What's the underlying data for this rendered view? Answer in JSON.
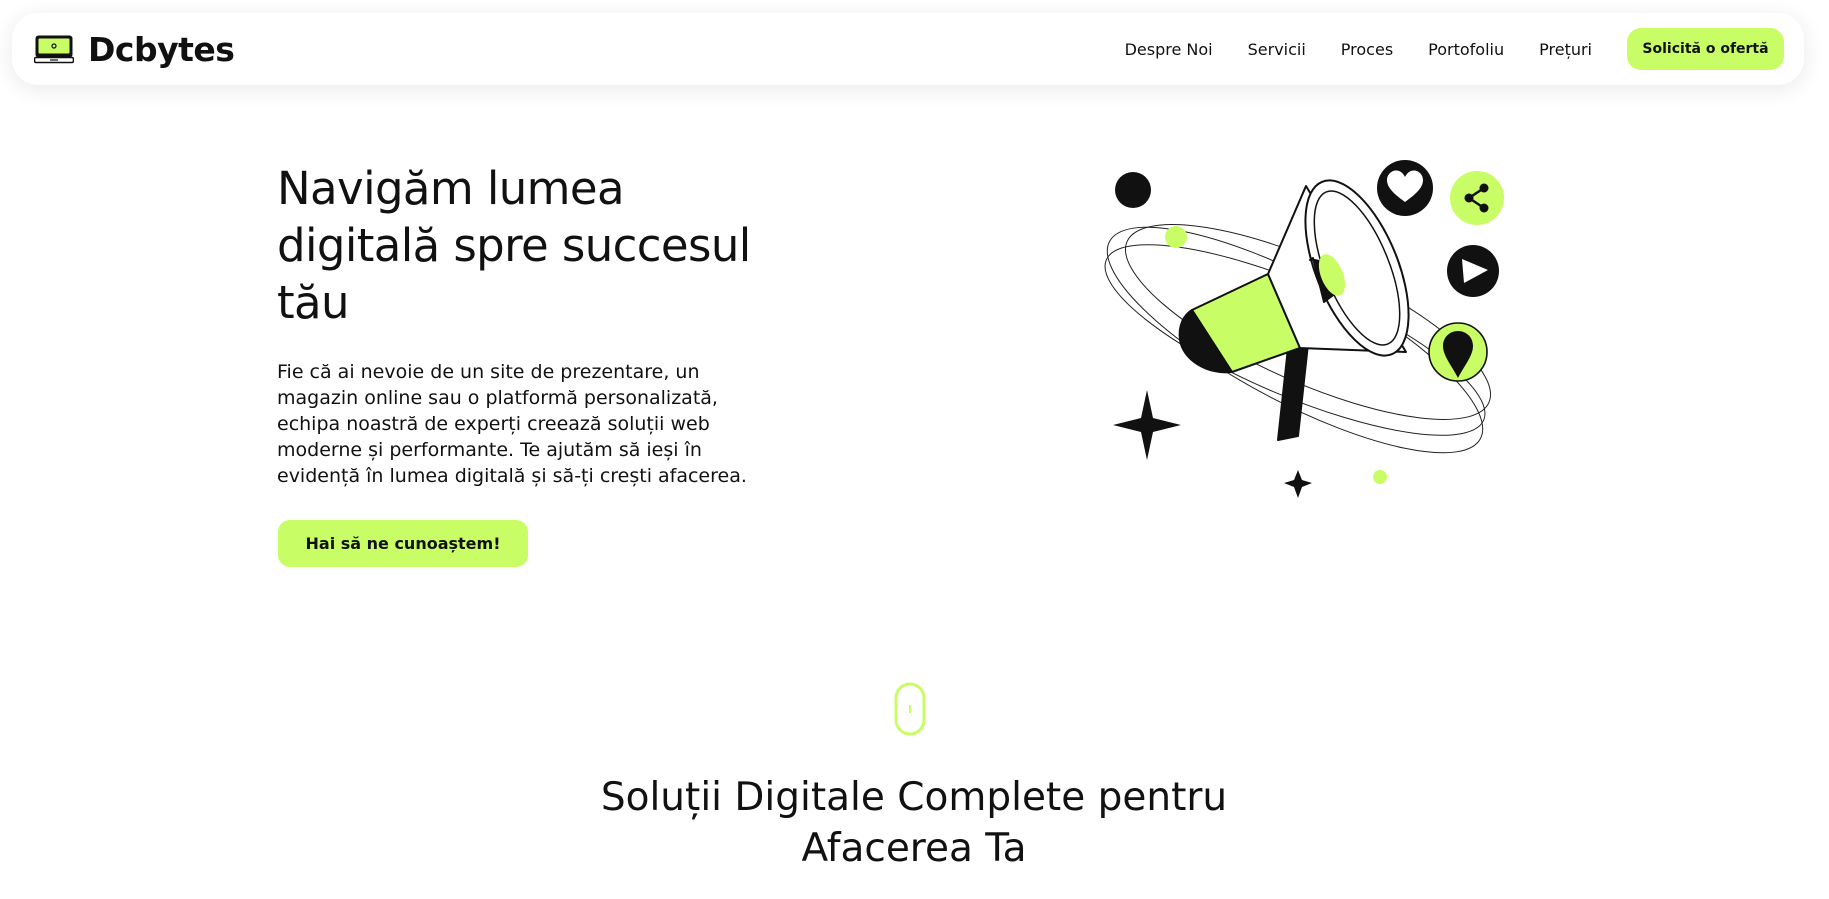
{
  "brand": {
    "name": "Dcbytes",
    "accent_color": "#c9fd66",
    "logo_icon": "laptop-icon"
  },
  "nav": {
    "links": [
      "Despre Noi",
      "Servicii",
      "Proces",
      "Portofoliu",
      "Prețuri"
    ],
    "cta_label": "Solicită o ofertă"
  },
  "hero": {
    "title": "Navigăm lumea digitală spre succesul tău",
    "description": "Fie că ai nevoie de un site de prezentare, un magazin online sau o platformă personalizată, echipa noastră de experți creează soluții web moderne și performante. Te ajutăm să ieși în evidență în lumea digitală și să-ți crești afacerea.",
    "cta_label": "Hai să ne cunoaștem!",
    "illustration": "megaphone-illustration",
    "illustration_icons": [
      "heart-icon",
      "share-icon",
      "play-icon",
      "location-pin-icon",
      "sparkle-icon"
    ]
  },
  "scroll_indicator": "mouse-scroll-icon",
  "services": {
    "title": "Soluții Digitale Complete pentru Afacerea Ta"
  }
}
